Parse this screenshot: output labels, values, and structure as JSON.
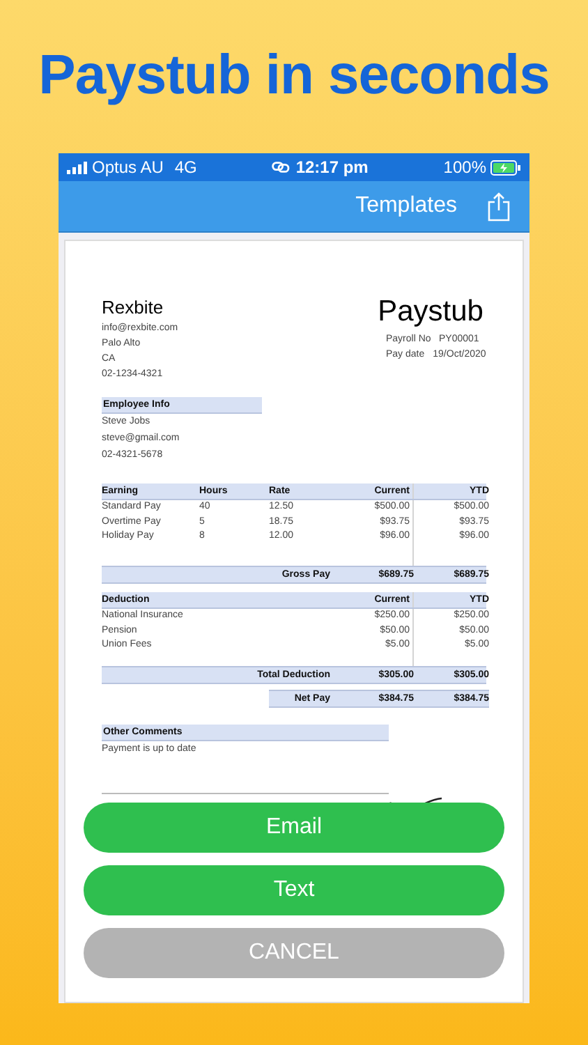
{
  "headline": "Paystub in seconds",
  "status_bar": {
    "carrier": "Optus AU",
    "network": "4G",
    "time": "12:17 pm",
    "battery": "100%",
    "charging": true
  },
  "nav": {
    "title": "Templates"
  },
  "paystub": {
    "company": "Rexbite",
    "company_lines": [
      "info@rexbite.com",
      "Palo Alto",
      "CA",
      "02-1234-4321"
    ],
    "title": "Paystub",
    "meta": [
      {
        "label": "Payroll No",
        "value": "PY00001"
      },
      {
        "label": "Pay date",
        "value": "19/Oct/2020"
      }
    ],
    "employee": {
      "heading": "Employee Info",
      "lines": [
        "Steve Jobs",
        "steve@gmail.com",
        "02-4321-5678"
      ]
    },
    "earnings": {
      "columns": [
        "Earning",
        "Hours",
        "Rate",
        "Current",
        "YTD"
      ],
      "rows": [
        [
          "Standard Pay",
          "40",
          "12.50",
          "$500.00",
          "$500.00"
        ],
        [
          "Overtime Pay",
          "5",
          "18.75",
          "$93.75",
          "$93.75"
        ],
        [
          "Holiday Pay",
          "8",
          "12.00",
          "$96.00",
          "$96.00"
        ]
      ],
      "total": {
        "label": "Gross Pay",
        "current": "$689.75",
        "ytd": "$689.75"
      }
    },
    "deductions": {
      "columns": [
        "Deduction",
        "Current",
        "YTD"
      ],
      "rows": [
        [
          "National Insurance",
          "$250.00",
          "$250.00"
        ],
        [
          "Pension",
          "$50.00",
          "$50.00"
        ],
        [
          "Union Fees",
          "$5.00",
          "$5.00"
        ]
      ],
      "total": {
        "label": "Total Deduction",
        "current": "$305.00",
        "ytd": "$305.00"
      }
    },
    "net": {
      "label": "Net Pay",
      "current": "$384.75",
      "ytd": "$384.75"
    },
    "comments": {
      "heading": "Other Comments",
      "text": "Payment is up to date"
    }
  },
  "actions": [
    {
      "label": "Email",
      "kind": "primary"
    },
    {
      "label": "Text",
      "kind": "primary"
    },
    {
      "label": "CANCEL",
      "kind": "cancel"
    }
  ]
}
